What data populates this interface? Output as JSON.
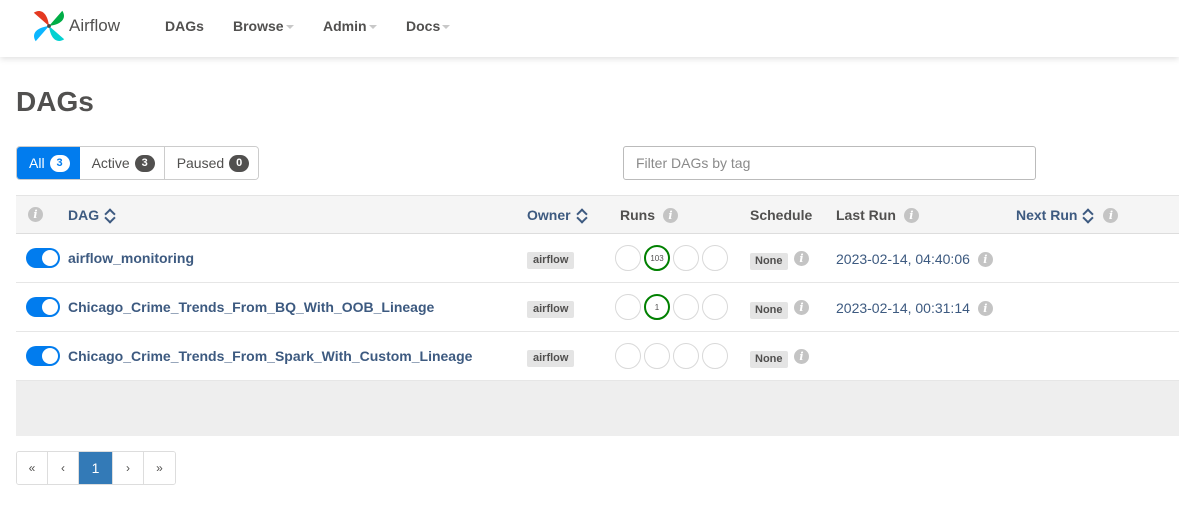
{
  "app": {
    "name": "Airflow"
  },
  "nav": {
    "items": [
      {
        "label": "DAGs",
        "dropdown": false
      },
      {
        "label": "Browse",
        "dropdown": true
      },
      {
        "label": "Admin",
        "dropdown": true
      },
      {
        "label": "Docs",
        "dropdown": true
      }
    ]
  },
  "page": {
    "title": "DAGs"
  },
  "status_filter": {
    "all": {
      "label": "All",
      "count": "3",
      "active": true
    },
    "active": {
      "label": "Active",
      "count": "3"
    },
    "paused": {
      "label": "Paused",
      "count": "0"
    }
  },
  "tag_filter": {
    "placeholder": "Filter DAGs by tag",
    "value": ""
  },
  "table": {
    "headers": {
      "dag": "DAG",
      "owner": "Owner",
      "runs": "Runs",
      "schedule": "Schedule",
      "last_run": "Last Run",
      "next_run": "Next Run"
    },
    "rows": [
      {
        "name": "airflow_monitoring",
        "owner": "airflow",
        "runs": [
          "",
          "103",
          "",
          ""
        ],
        "schedule": "None",
        "last_run": "2023-02-14, 04:40:06",
        "paused": false
      },
      {
        "name": "Chicago_Crime_Trends_From_BQ_With_OOB_Lineage",
        "owner": "airflow",
        "runs": [
          "",
          "1",
          "",
          ""
        ],
        "schedule": "None",
        "last_run": "2023-02-14, 00:31:14",
        "paused": false
      },
      {
        "name": "Chicago_Crime_Trends_From_Spark_With_Custom_Lineage",
        "owner": "airflow",
        "runs": [
          "",
          "",
          "",
          ""
        ],
        "schedule": "None",
        "last_run": "",
        "paused": false
      }
    ]
  },
  "pagination": {
    "first": "«",
    "prev": "‹",
    "current": "1",
    "next": "›",
    "last": "»"
  },
  "colors": {
    "accent": "#017cee",
    "link": "#3d5a80",
    "success": "#008000",
    "page_active": "#337ab7"
  },
  "icons": {
    "info": "info-circle-icon",
    "sort": "sort-icon",
    "logo": "airflow-pinwheel-logo"
  }
}
